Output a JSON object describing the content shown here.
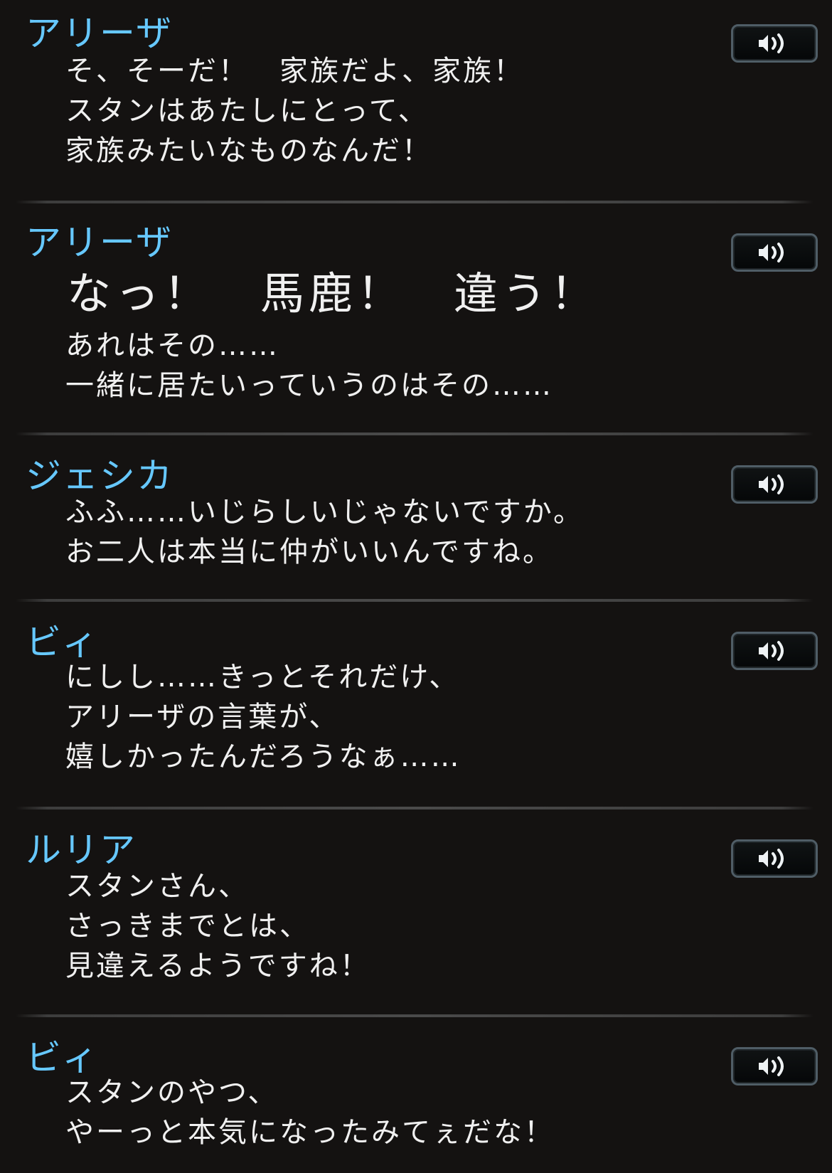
{
  "entries": [
    {
      "speaker": "アリーザ",
      "lines": [
        "そ、そーだ！　家族だよ、家族！",
        "スタンはあたしにとって、",
        "家族みたいなものなんだ！"
      ]
    },
    {
      "speaker": "アリーザ",
      "emphasis": "なっ！　馬鹿！　違う！",
      "lines": [
        "あれはその……",
        "一緒に居たいっていうのはその……"
      ]
    },
    {
      "speaker": "ジェシカ",
      "lines": [
        "ふふ……いじらしいじゃないですか。",
        "お二人は本当に仲がいいんですね。"
      ]
    },
    {
      "speaker": "ビィ",
      "lines": [
        "にしし……きっとそれだけ、",
        "アリーザの言葉が、",
        "嬉しかったんだろうなぁ……"
      ]
    },
    {
      "speaker": "ルリア",
      "lines": [
        "スタンさん、",
        "さっきまでとは、",
        "見違えるようですね！"
      ]
    },
    {
      "speaker": "ビィ",
      "lines": [
        "スタンのやつ、",
        "やーっと本気になったみてぇだな！"
      ]
    }
  ],
  "voice_button_icon": "speaker-volume-icon",
  "colors": {
    "background": "#141211",
    "speaker_name": "#66c8ff",
    "dialogue_text": "#f0f0f0",
    "button_border": "#4f5d66"
  }
}
